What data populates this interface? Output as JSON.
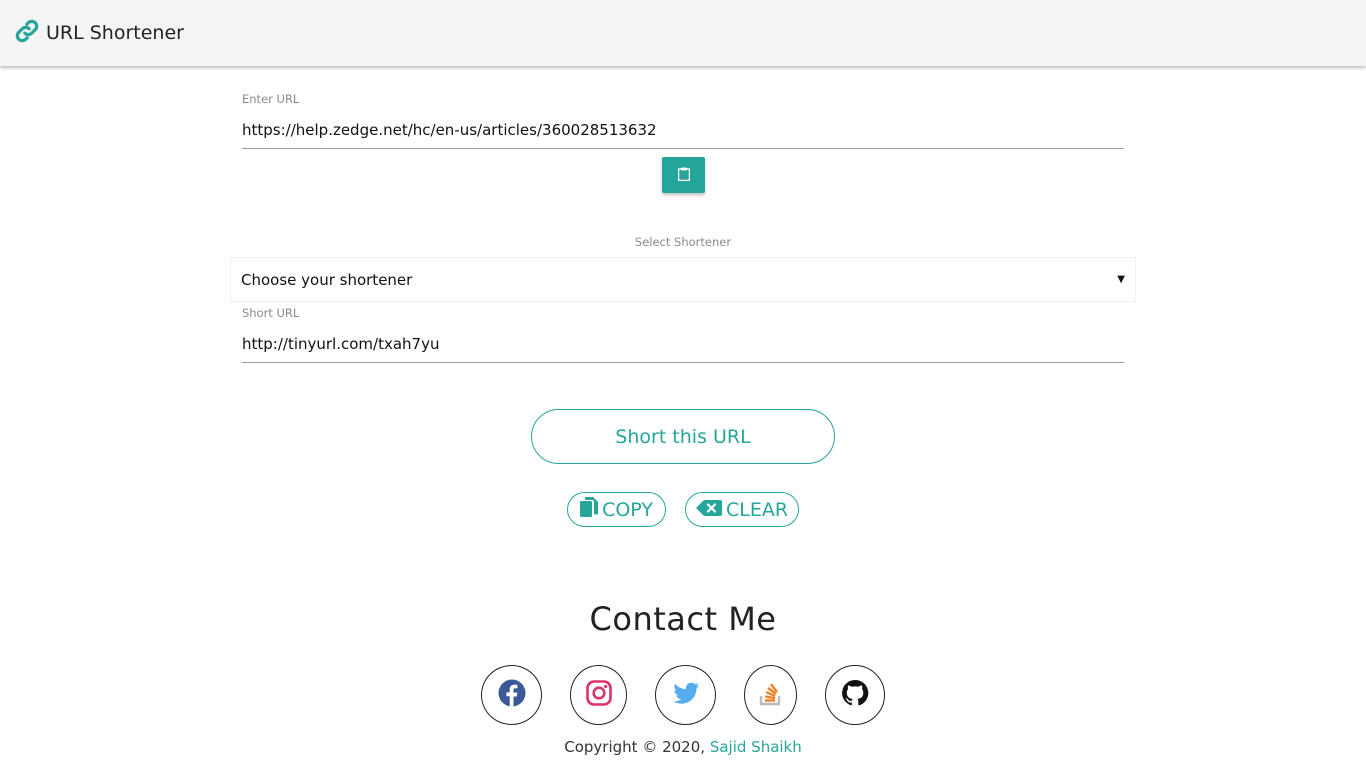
{
  "navbar": {
    "brand_title": "URL Shortener",
    "brand_icon": "link-icon",
    "accent": "#26a69a"
  },
  "form": {
    "url_label": "Enter URL",
    "url_value": "https://help.zedge.net/hc/en-us/articles/360028513632",
    "paste_icon": "clipboard-icon",
    "select_label": "Select Shortener",
    "select_value": "Choose your shortener",
    "short_label": "Short URL",
    "short_value": "http://tinyurl.com/txah7yu"
  },
  "actions": {
    "short_button": "Short this URL",
    "copy_button": "COPY",
    "copy_icon": "copy-icon",
    "clear_button": "CLEAR",
    "clear_icon": "backspace-icon"
  },
  "contact": {
    "title": "Contact Me",
    "socials": [
      {
        "name": "facebook-icon",
        "color": "#3b5998"
      },
      {
        "name": "instagram-icon",
        "color": "#e1306c"
      },
      {
        "name": "twitter-icon",
        "color": "#55acee"
      },
      {
        "name": "stackoverflow-icon",
        "color": "#f48024"
      },
      {
        "name": "github-icon",
        "color": "#111111"
      }
    ]
  },
  "footer": {
    "prefix": "Copyright",
    "copyright_symbol": "©",
    "year": "2020,",
    "author": "Sajid Shaikh"
  }
}
